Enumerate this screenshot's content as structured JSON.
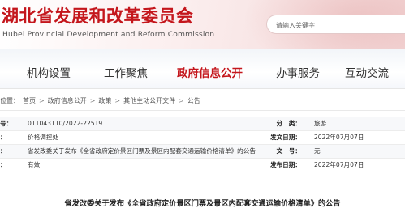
{
  "header": {
    "title_cn": "湖北省发展和改革委员会",
    "title_en": "Hubei Provincial Development and Reform Commission",
    "search_placeholder": "请输入关键字"
  },
  "nav": {
    "items": [
      {
        "label": "机构设置",
        "active": false
      },
      {
        "label": "工作聚焦",
        "active": false
      },
      {
        "label": "政府信息公开",
        "active": true
      },
      {
        "label": "办事服务",
        "active": false
      },
      {
        "label": "互动交流",
        "active": false
      }
    ]
  },
  "breadcrumb": {
    "location_label": "位置：",
    "items": [
      "首页",
      "政府信息公开",
      "政策",
      "其他主动公开文件",
      "公告"
    ],
    "separator": ">"
  },
  "info": {
    "rows": [
      {
        "k": "号：",
        "v": "011043110/2022-22519",
        "k2": "分　类：",
        "v2": "旅游"
      },
      {
        "k": "：",
        "v": "价格调控处",
        "k2": "发文日期：",
        "v2": "2022年07月07日"
      },
      {
        "k": "：",
        "v": "省发改委关于发布《全省政府定价景区门票及景区内配套交通运输价格清单》的公告",
        "k2": "文　号：",
        "v2": "无"
      },
      {
        "k": "：",
        "v": "有效",
        "k2": "发布日期：",
        "v2": "2022年07月07日"
      }
    ]
  },
  "doc_title": "省发改委关于发布《全省政府定价景区门票及景区内配套交通运输价格清单》的公告"
}
